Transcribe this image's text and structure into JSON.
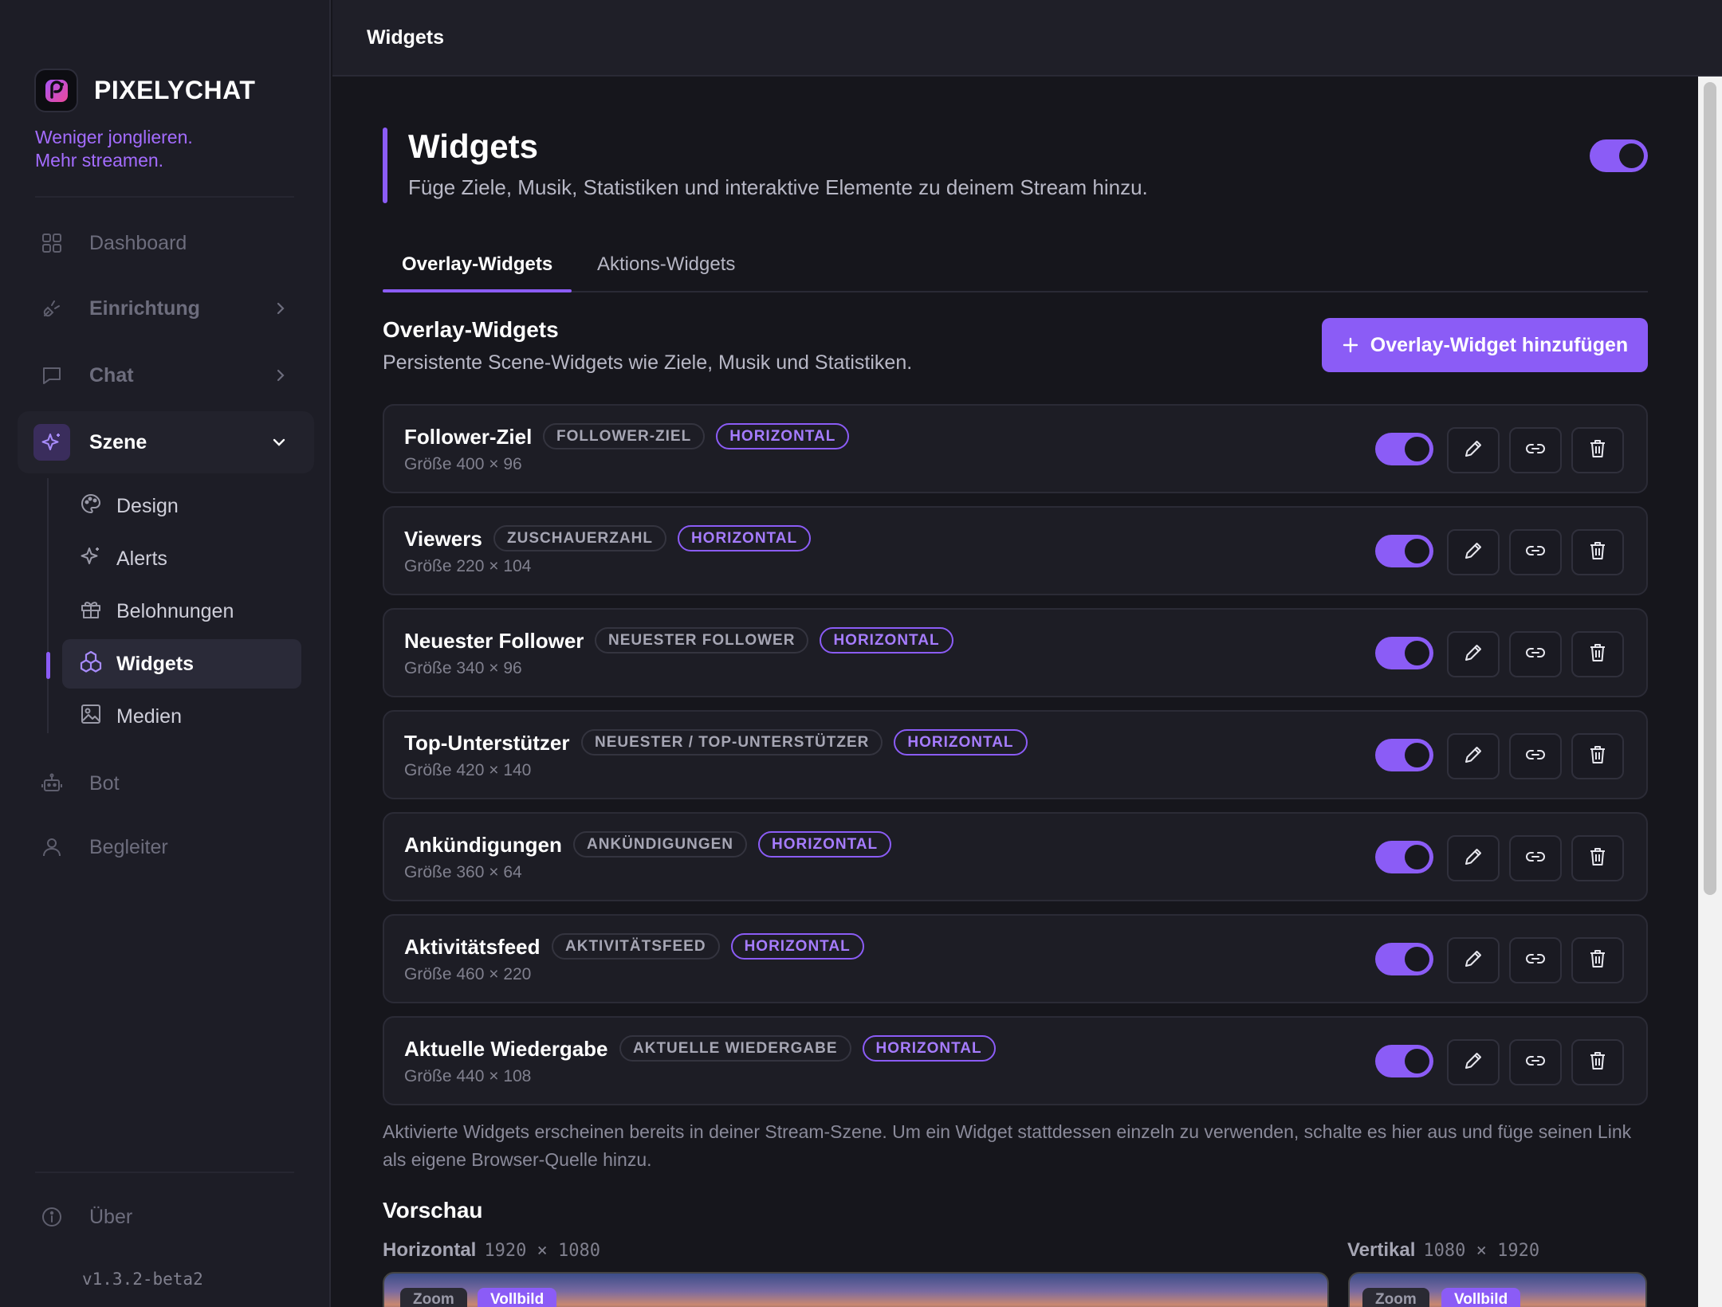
{
  "app": {
    "brand": "PIXELYCHAT",
    "tagline_line1": "Weniger jonglieren.",
    "tagline_line2": "Mehr streamen.",
    "version": "v1.3.2-beta2",
    "accent_color": "#8b5cf6"
  },
  "topbar": {
    "title": "Widgets"
  },
  "sidebar": {
    "items": [
      {
        "label": "Dashboard",
        "icon": "grid-icon"
      },
      {
        "label": "Einrichtung",
        "icon": "plug-icon"
      },
      {
        "label": "Chat",
        "icon": "chat-bubble-icon"
      },
      {
        "label": "Szene",
        "icon": "sparkle-icon"
      },
      {
        "label": "Bot",
        "icon": "robot-icon"
      },
      {
        "label": "Begleiter",
        "icon": "user-icon"
      },
      {
        "label": "Über",
        "icon": "info-icon"
      }
    ],
    "sub_items": [
      {
        "label": "Design",
        "icon": "palette-icon"
      },
      {
        "label": "Alerts",
        "icon": "sparkle-icon"
      },
      {
        "label": "Belohnungen",
        "icon": "gift-icon"
      },
      {
        "label": "Widgets",
        "icon": "widgets-icon"
      },
      {
        "label": "Medien",
        "icon": "image-icon"
      }
    ]
  },
  "page": {
    "title": "Widgets",
    "subtitle": "Füge Ziele, Musik, Statistiken und interaktive Elemente zu deinem Stream hinzu.",
    "master_toggle_on": true
  },
  "tabs": [
    {
      "label": "Overlay-Widgets",
      "active": true
    },
    {
      "label": "Aktions-Widgets",
      "active": false
    }
  ],
  "section": {
    "title": "Overlay-Widgets",
    "subtitle": "Persistente Scene-Widgets wie Ziele, Musik und Statistiken.",
    "add_button": "Overlay-Widget hinzufügen"
  },
  "widgets": [
    {
      "name": "Follower-Ziel",
      "type": "FOLLOWER-ZIEL",
      "orientation": "HORIZONTAL",
      "size": "Größe 400 × 96",
      "enabled": true
    },
    {
      "name": "Viewers",
      "type": "ZUSCHAUERZAHL",
      "orientation": "HORIZONTAL",
      "size": "Größe 220 × 104",
      "enabled": true
    },
    {
      "name": "Neuester Follower",
      "type": "NEUESTER FOLLOWER",
      "orientation": "HORIZONTAL",
      "size": "Größe 340 × 96",
      "enabled": true
    },
    {
      "name": "Top-Unterstützer",
      "type": "NEUESTER / TOP-UNTERSTÜTZER",
      "orientation": "HORIZONTAL",
      "size": "Größe 420 × 140",
      "enabled": true
    },
    {
      "name": "Ankündigungen",
      "type": "ANKÜNDIGUNGEN",
      "orientation": "HORIZONTAL",
      "size": "Größe 360 × 64",
      "enabled": true
    },
    {
      "name": "Aktivitätsfeed",
      "type": "AKTIVITÄTSFEED",
      "orientation": "HORIZONTAL",
      "size": "Größe 460 × 220",
      "enabled": true
    },
    {
      "name": "Aktuelle Wiedergabe",
      "type": "AKTUELLE WIEDERGABE",
      "orientation": "HORIZONTAL",
      "size": "Größe 440 × 108",
      "enabled": true
    }
  ],
  "footnote": "Aktivierte Widgets erscheinen bereits in deiner Stream-Szene. Um ein Widget stattdessen einzeln zu verwenden, schalte es hier aus und füge seinen Link als eigene Browser-Quelle hinzu.",
  "preview": {
    "title": "Vorschau",
    "horizontal": {
      "label": "Horizontal",
      "dims": "1920 × 1080"
    },
    "vertical": {
      "label": "Vertikal",
      "dims": "1080 × 1920"
    },
    "zoom_label": "Zoom",
    "fullscreen_label": "Vollbild"
  }
}
